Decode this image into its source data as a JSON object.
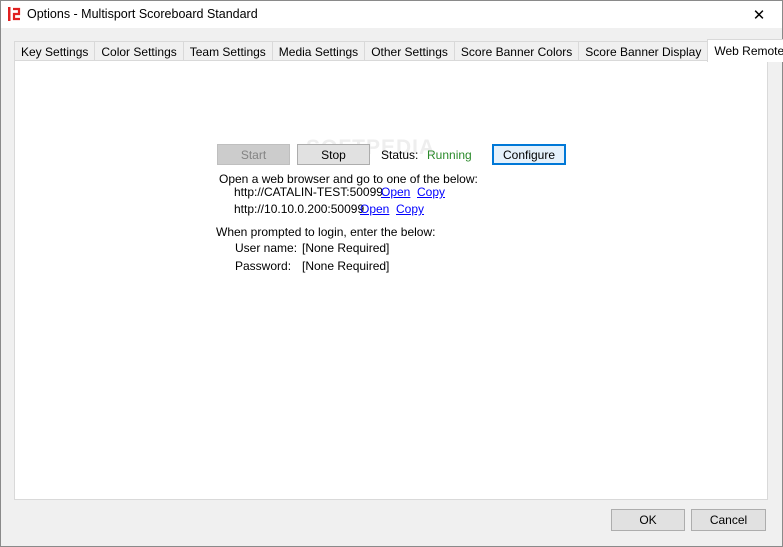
{
  "window": {
    "title": "Options - Multisport Scoreboard Standard"
  },
  "icons": {
    "app": "app-logo-icon",
    "close": "close-icon"
  },
  "tabs": [
    {
      "label": "Key Settings"
    },
    {
      "label": "Color Settings"
    },
    {
      "label": "Team Settings"
    },
    {
      "label": "Media Settings"
    },
    {
      "label": "Other Settings"
    },
    {
      "label": "Score Banner Colors"
    },
    {
      "label": "Score Banner Display"
    },
    {
      "label": "Web Remote",
      "active": true
    }
  ],
  "web_remote": {
    "start_label": "Start",
    "stop_label": "Stop",
    "status_label": "Status:",
    "status_value": "Running",
    "configure_label": "Configure",
    "instructions": "Open a web browser and go to one of the below:",
    "urls": [
      {
        "url": "http://CATALIN-TEST:50099",
        "open": "Open",
        "copy": "Copy"
      },
      {
        "url": "http://10.10.0.200:50099",
        "open": "Open",
        "copy": "Copy"
      }
    ],
    "login_prompt": "When prompted to login, enter the below:",
    "username_label": "User name:",
    "username_value": "[None Required]",
    "password_label": "Password:",
    "password_value": "[None Required]"
  },
  "footer": {
    "ok_label": "OK",
    "cancel_label": "Cancel"
  },
  "watermark": "SOFTPEDIA",
  "colors": {
    "status_running": "#2a8a2a",
    "link": "#0000ff",
    "focus": "#0078d7"
  }
}
